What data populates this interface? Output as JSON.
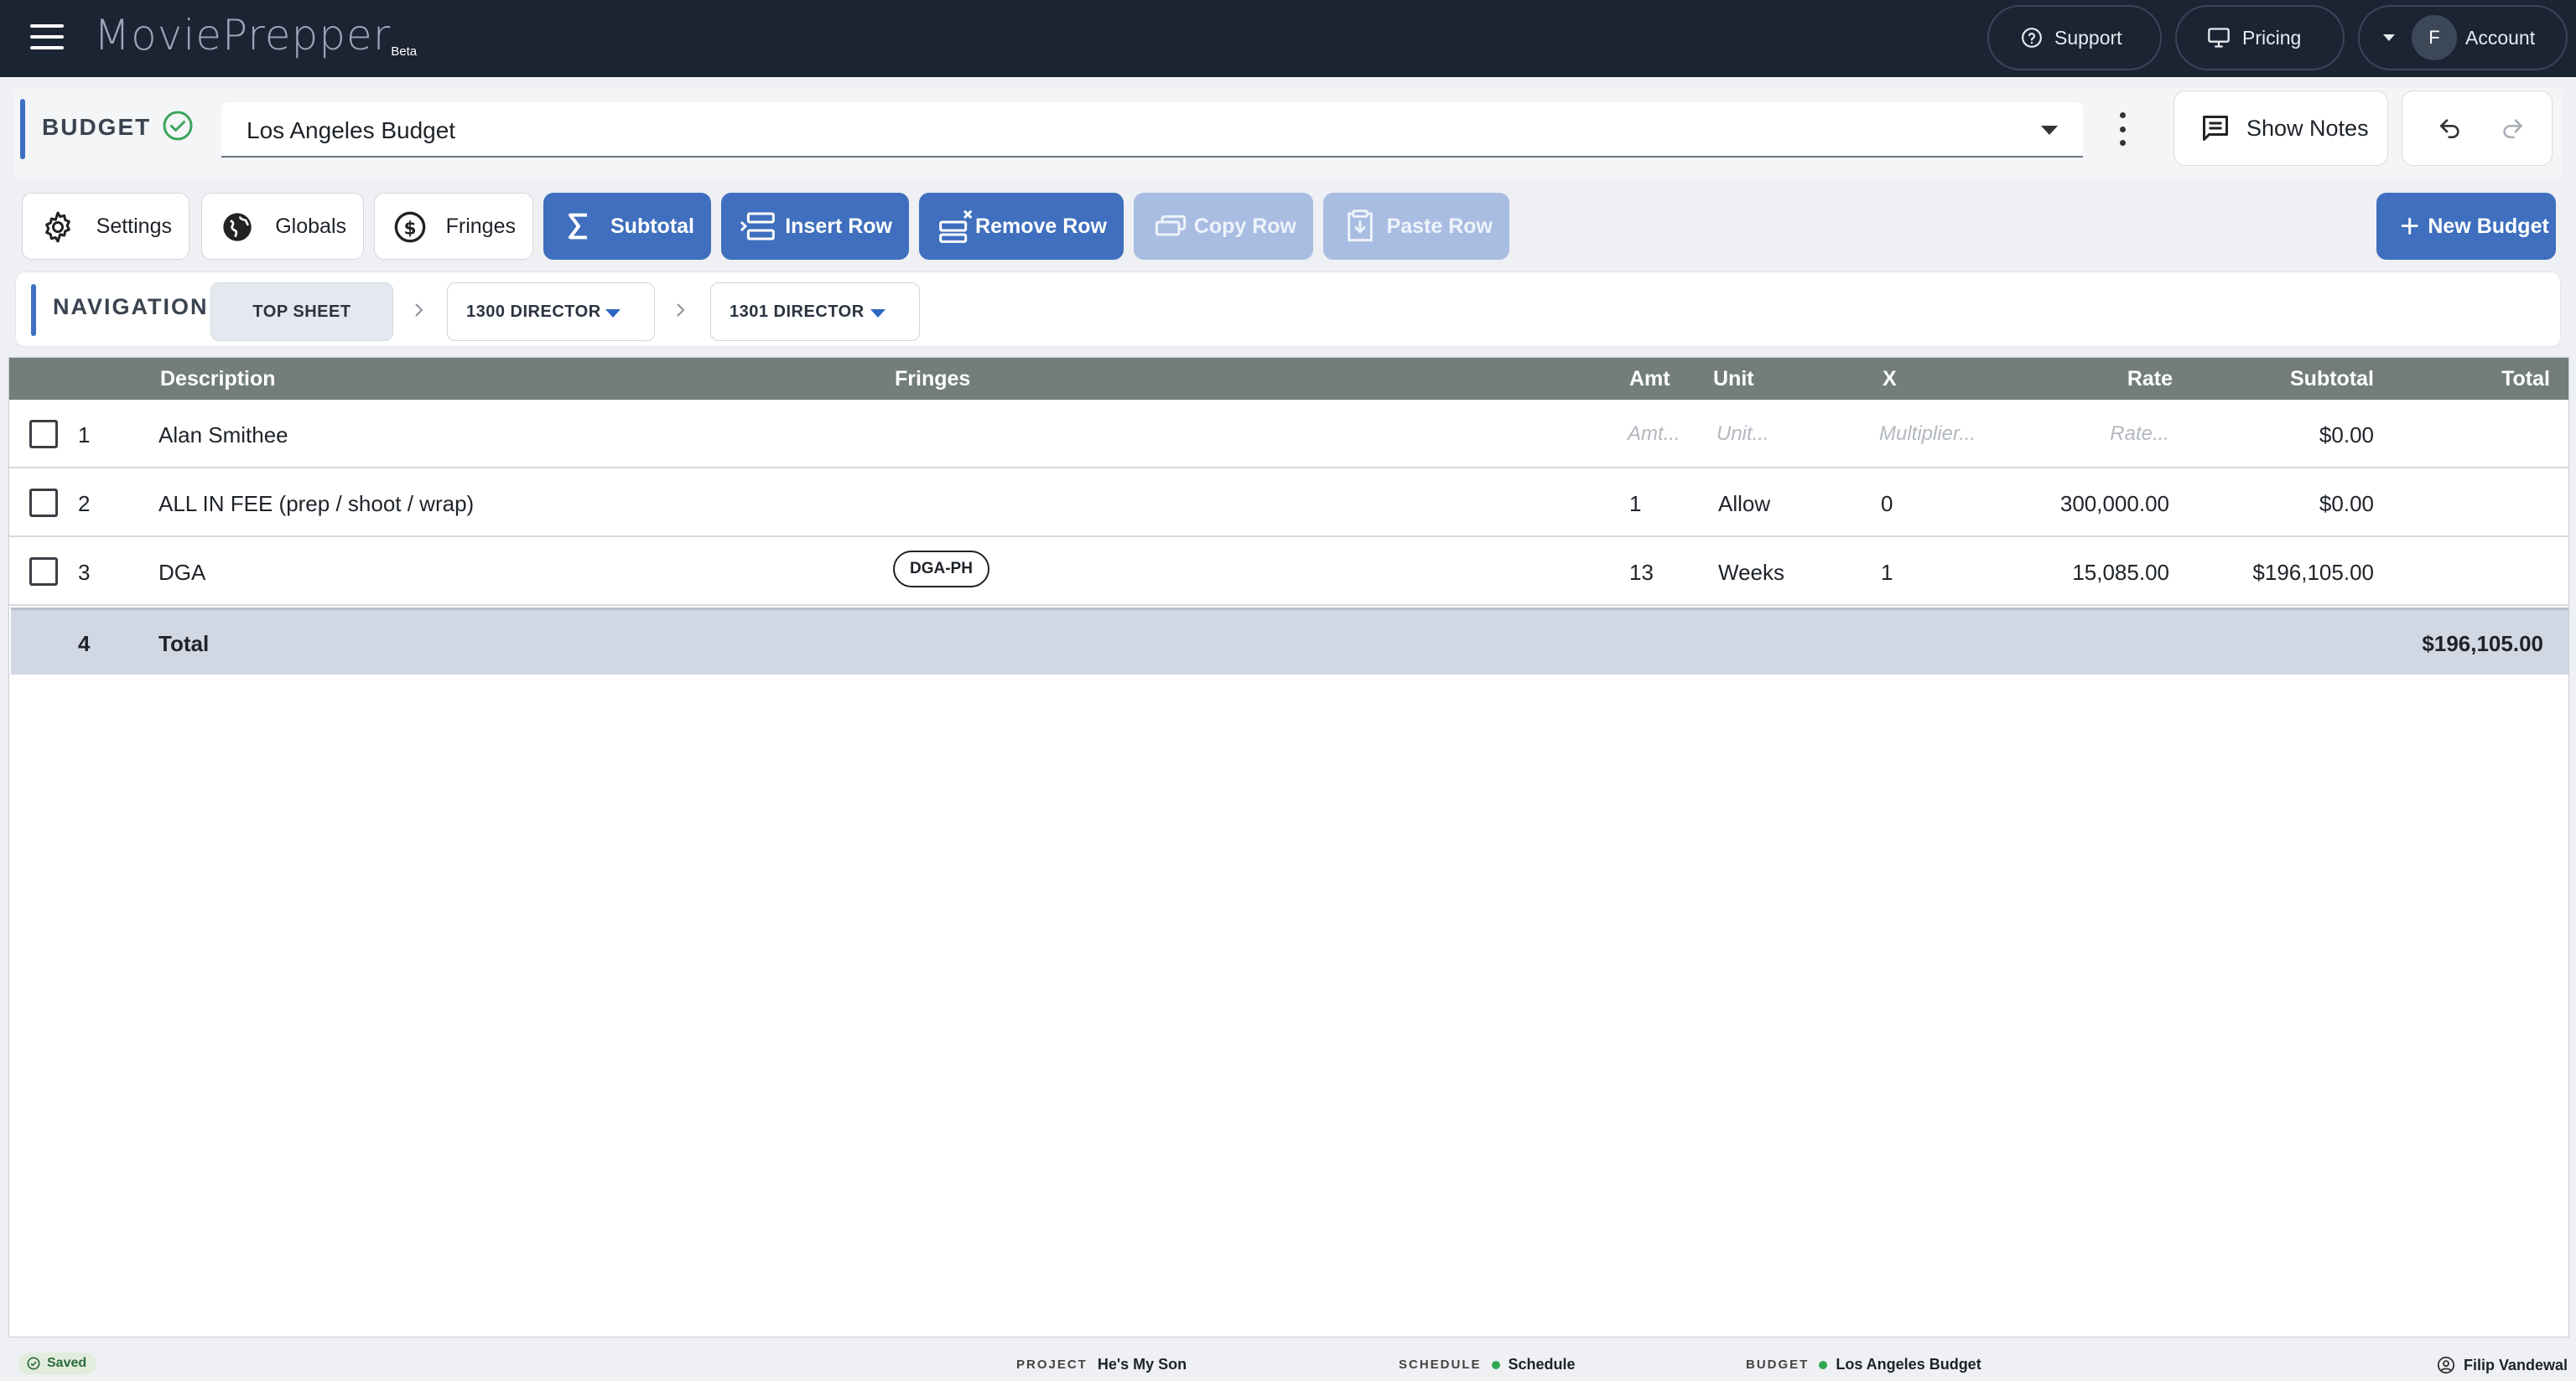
{
  "app": {
    "logo_text": "MoviePrepper",
    "beta_label": "Beta",
    "support_label": "Support",
    "pricing_label": "Pricing",
    "account_initial": "F",
    "account_label": "Account"
  },
  "budget_header": {
    "label": "BUDGET",
    "selected_budget": "Los Angeles Budget",
    "show_notes_label": "Show Notes"
  },
  "toolbar": {
    "settings": "Settings",
    "globals": "Globals",
    "fringes": "Fringes",
    "subtotal": "Subtotal",
    "insert_row": "Insert Row",
    "remove_row": "Remove Row",
    "copy_row": "Copy Row",
    "paste_row": "Paste Row",
    "new_budget": "New Budget"
  },
  "navigation": {
    "label": "NAVIGATION",
    "crumbs": [
      "TOP SHEET",
      "1300 DIRECTOR",
      "1301 DIRECTOR"
    ]
  },
  "table": {
    "columns": [
      "Description",
      "Fringes",
      "Amt",
      "Unit",
      "X",
      "Rate",
      "Subtotal",
      "Total"
    ],
    "placeholders": {
      "amt": "Amt...",
      "unit": "Unit...",
      "x": "Multiplier...",
      "rate": "Rate..."
    },
    "rows": [
      {
        "num": "1",
        "description": "Alan Smithee",
        "fringe": "",
        "amt": "",
        "unit": "",
        "x": "",
        "rate": "",
        "subtotal": "$0.00"
      },
      {
        "num": "2",
        "description": "ALL IN FEE (prep / shoot / wrap)",
        "fringe": "",
        "amt": "1",
        "unit": "Allow",
        "x": "0",
        "rate": "300,000.00",
        "subtotal": "$0.00"
      },
      {
        "num": "3",
        "description": "DGA",
        "fringe": "DGA-PH",
        "amt": "13",
        "unit": "Weeks",
        "x": "1",
        "rate": "15,085.00",
        "subtotal": "$196,105.00"
      }
    ],
    "total_row": {
      "num": "4",
      "label": "Total",
      "total": "$196,105.00"
    }
  },
  "status": {
    "saved": "Saved",
    "project_label": "PROJECT",
    "project_value": "He's My Son",
    "schedule_label": "SCHEDULE",
    "schedule_value": "Schedule",
    "budget_label": "BUDGET",
    "budget_value": "Los Angeles Budget",
    "user": "Filip Vandewal"
  }
}
